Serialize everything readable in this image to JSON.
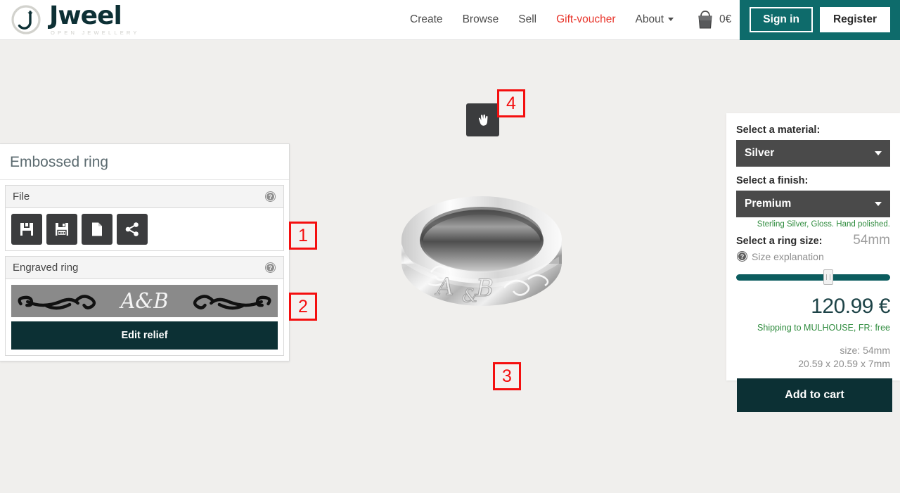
{
  "header": {
    "brand": {
      "word": "Jweel",
      "tagline": "OPEN JEWELLERY",
      "logo_icon": "jweel-circle-logo"
    },
    "nav": [
      {
        "label": "Create",
        "accent": false,
        "caret": false
      },
      {
        "label": "Browse",
        "accent": false,
        "caret": false
      },
      {
        "label": "Sell",
        "accent": false,
        "caret": false
      },
      {
        "label": "Gift-voucher",
        "accent": true,
        "caret": false
      },
      {
        "label": "About",
        "accent": false,
        "caret": true
      }
    ],
    "cart": {
      "icon": "shopping-bag-icon",
      "total": "0€"
    },
    "auth": {
      "sign_in": "Sign in",
      "register": "Register"
    },
    "colors": {
      "teal": "#0e6b6b",
      "accent_red": "#e8342a",
      "brand_dark": "#0d3035"
    }
  },
  "viewport": {
    "pan_tool_icon": "hand-pan-icon",
    "model_name": "Embossed silver ring with A&B relief"
  },
  "left_panel": {
    "title": "Embossed ring",
    "sections": [
      {
        "title": "File",
        "help_icon": "question-circle-icon",
        "tools": [
          {
            "name": "save-icon",
            "label": "Save"
          },
          {
            "name": "save-as-icon",
            "label": "Save as"
          },
          {
            "name": "new-file-icon",
            "label": "New"
          },
          {
            "name": "share-icon",
            "label": "Share"
          }
        ]
      },
      {
        "title": "Engraved ring",
        "help_icon": "question-circle-icon",
        "preview_alt": "A&B ornamental relief preview",
        "edit_button": "Edit relief"
      }
    ]
  },
  "right_panel": {
    "material_label": "Select a material:",
    "material_value": "Silver",
    "finish_label": "Select a finish:",
    "finish_value": "Premium",
    "finish_note": "Sterling Silver, Gloss. Hand polished.",
    "size_label": "Select a ring size:",
    "size_value": "54mm",
    "size_explanation": "Size explanation",
    "size_help_icon": "question-circle-icon",
    "slider_percent": 60,
    "price": "120.99 €",
    "shipping": "Shipping to MULHOUSE, FR: free",
    "dim_size": "size: 54mm",
    "dim_box": "20.59 x 20.59 x 7mm",
    "add_to_cart": "Add to cart",
    "colors": {
      "note_green": "#2e8b3d",
      "price_teal": "#1d4347",
      "button_dark": "#0c3034"
    }
  },
  "annotations": {
    "color": "#f40f0f",
    "markers": [
      {
        "id": "1",
        "label": "1"
      },
      {
        "id": "2",
        "label": "2"
      },
      {
        "id": "3",
        "label": "3"
      },
      {
        "id": "4",
        "label": "4"
      }
    ]
  }
}
